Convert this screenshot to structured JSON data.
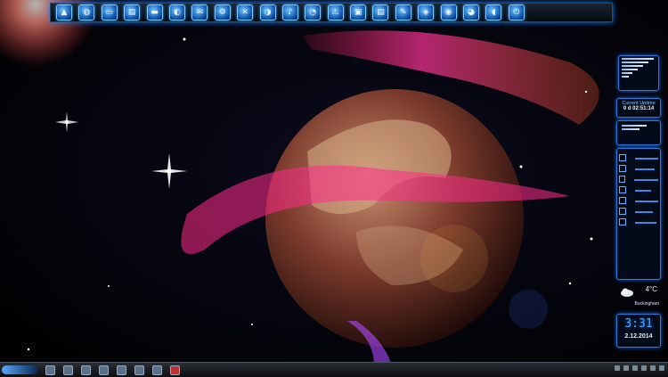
{
  "dock": {
    "icons": [
      "triangle-up",
      "globe",
      "monitor",
      "trash",
      "folder",
      "globe-blue",
      "mail",
      "cog",
      "x",
      "media",
      "sound",
      "search",
      "warning",
      "printer",
      "document",
      "pen",
      "shield",
      "globe-2",
      "headphones",
      "mouse",
      "power"
    ]
  },
  "gadgets": {
    "uptime_label": "Current Uptime",
    "uptime_value": "0 d 02:51:14",
    "clock_time": "3:31",
    "clock_date": "2.12.2014",
    "weather_temp": "4°C",
    "weather_city": "Buckingham"
  },
  "colors": {
    "accent": "#1b7bff",
    "panel": "#030c1c"
  }
}
